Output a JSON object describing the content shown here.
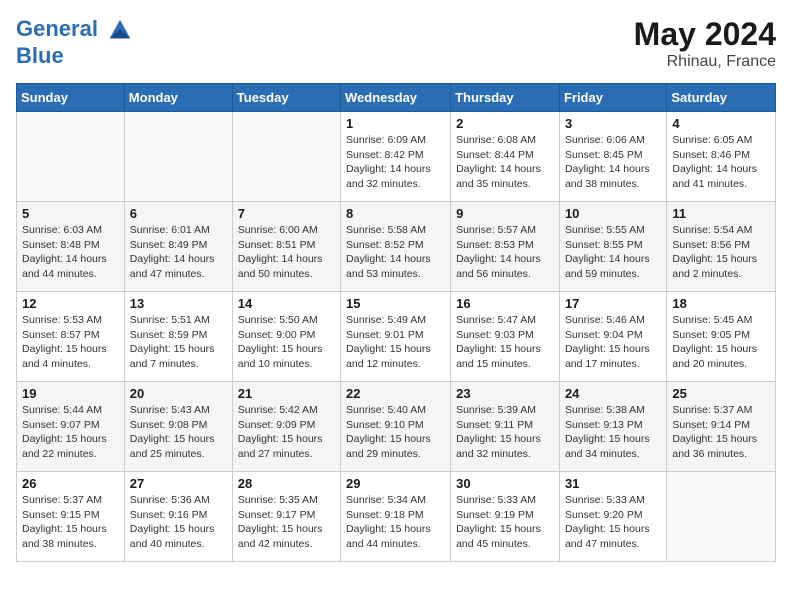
{
  "header": {
    "logo_line1": "General",
    "logo_line2": "Blue",
    "month_year": "May 2024",
    "location": "Rhinau, France"
  },
  "weekdays": [
    "Sunday",
    "Monday",
    "Tuesday",
    "Wednesday",
    "Thursday",
    "Friday",
    "Saturday"
  ],
  "weeks": [
    [
      {
        "day": "",
        "info": ""
      },
      {
        "day": "",
        "info": ""
      },
      {
        "day": "",
        "info": ""
      },
      {
        "day": "1",
        "info": "Sunrise: 6:09 AM\nSunset: 8:42 PM\nDaylight: 14 hours\nand 32 minutes."
      },
      {
        "day": "2",
        "info": "Sunrise: 6:08 AM\nSunset: 8:44 PM\nDaylight: 14 hours\nand 35 minutes."
      },
      {
        "day": "3",
        "info": "Sunrise: 6:06 AM\nSunset: 8:45 PM\nDaylight: 14 hours\nand 38 minutes."
      },
      {
        "day": "4",
        "info": "Sunrise: 6:05 AM\nSunset: 8:46 PM\nDaylight: 14 hours\nand 41 minutes."
      }
    ],
    [
      {
        "day": "5",
        "info": "Sunrise: 6:03 AM\nSunset: 8:48 PM\nDaylight: 14 hours\nand 44 minutes."
      },
      {
        "day": "6",
        "info": "Sunrise: 6:01 AM\nSunset: 8:49 PM\nDaylight: 14 hours\nand 47 minutes."
      },
      {
        "day": "7",
        "info": "Sunrise: 6:00 AM\nSunset: 8:51 PM\nDaylight: 14 hours\nand 50 minutes."
      },
      {
        "day": "8",
        "info": "Sunrise: 5:58 AM\nSunset: 8:52 PM\nDaylight: 14 hours\nand 53 minutes."
      },
      {
        "day": "9",
        "info": "Sunrise: 5:57 AM\nSunset: 8:53 PM\nDaylight: 14 hours\nand 56 minutes."
      },
      {
        "day": "10",
        "info": "Sunrise: 5:55 AM\nSunset: 8:55 PM\nDaylight: 14 hours\nand 59 minutes."
      },
      {
        "day": "11",
        "info": "Sunrise: 5:54 AM\nSunset: 8:56 PM\nDaylight: 15 hours\nand 2 minutes."
      }
    ],
    [
      {
        "day": "12",
        "info": "Sunrise: 5:53 AM\nSunset: 8:57 PM\nDaylight: 15 hours\nand 4 minutes."
      },
      {
        "day": "13",
        "info": "Sunrise: 5:51 AM\nSunset: 8:59 PM\nDaylight: 15 hours\nand 7 minutes."
      },
      {
        "day": "14",
        "info": "Sunrise: 5:50 AM\nSunset: 9:00 PM\nDaylight: 15 hours\nand 10 minutes."
      },
      {
        "day": "15",
        "info": "Sunrise: 5:49 AM\nSunset: 9:01 PM\nDaylight: 15 hours\nand 12 minutes."
      },
      {
        "day": "16",
        "info": "Sunrise: 5:47 AM\nSunset: 9:03 PM\nDaylight: 15 hours\nand 15 minutes."
      },
      {
        "day": "17",
        "info": "Sunrise: 5:46 AM\nSunset: 9:04 PM\nDaylight: 15 hours\nand 17 minutes."
      },
      {
        "day": "18",
        "info": "Sunrise: 5:45 AM\nSunset: 9:05 PM\nDaylight: 15 hours\nand 20 minutes."
      }
    ],
    [
      {
        "day": "19",
        "info": "Sunrise: 5:44 AM\nSunset: 9:07 PM\nDaylight: 15 hours\nand 22 minutes."
      },
      {
        "day": "20",
        "info": "Sunrise: 5:43 AM\nSunset: 9:08 PM\nDaylight: 15 hours\nand 25 minutes."
      },
      {
        "day": "21",
        "info": "Sunrise: 5:42 AM\nSunset: 9:09 PM\nDaylight: 15 hours\nand 27 minutes."
      },
      {
        "day": "22",
        "info": "Sunrise: 5:40 AM\nSunset: 9:10 PM\nDaylight: 15 hours\nand 29 minutes."
      },
      {
        "day": "23",
        "info": "Sunrise: 5:39 AM\nSunset: 9:11 PM\nDaylight: 15 hours\nand 32 minutes."
      },
      {
        "day": "24",
        "info": "Sunrise: 5:38 AM\nSunset: 9:13 PM\nDaylight: 15 hours\nand 34 minutes."
      },
      {
        "day": "25",
        "info": "Sunrise: 5:37 AM\nSunset: 9:14 PM\nDaylight: 15 hours\nand 36 minutes."
      }
    ],
    [
      {
        "day": "26",
        "info": "Sunrise: 5:37 AM\nSunset: 9:15 PM\nDaylight: 15 hours\nand 38 minutes."
      },
      {
        "day": "27",
        "info": "Sunrise: 5:36 AM\nSunset: 9:16 PM\nDaylight: 15 hours\nand 40 minutes."
      },
      {
        "day": "28",
        "info": "Sunrise: 5:35 AM\nSunset: 9:17 PM\nDaylight: 15 hours\nand 42 minutes."
      },
      {
        "day": "29",
        "info": "Sunrise: 5:34 AM\nSunset: 9:18 PM\nDaylight: 15 hours\nand 44 minutes."
      },
      {
        "day": "30",
        "info": "Sunrise: 5:33 AM\nSunset: 9:19 PM\nDaylight: 15 hours\nand 45 minutes."
      },
      {
        "day": "31",
        "info": "Sunrise: 5:33 AM\nSunset: 9:20 PM\nDaylight: 15 hours\nand 47 minutes."
      },
      {
        "day": "",
        "info": ""
      }
    ]
  ]
}
